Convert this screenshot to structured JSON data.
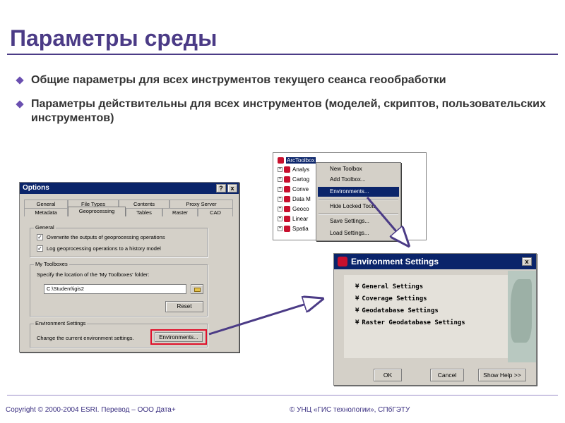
{
  "slide": {
    "title": "Параметры среды",
    "bullets": [
      "Общие параметры для всех инструментов текущего сеанса геообработки",
      "Параметры действительны для всех инструментов (моделей, скриптов, пользовательских инструментов)"
    ]
  },
  "options_dialog": {
    "title": "Options",
    "help_button": "?",
    "close_button": "x",
    "tabs_back": [
      "General",
      "File Types",
      "Contents",
      "Proxy Server"
    ],
    "tabs_front": [
      "Metadata",
      "Geoprocessing",
      "Tables",
      "Raster",
      "CAD"
    ],
    "active_tab": "Geoprocessing",
    "general_group": {
      "label": "General",
      "checkbox1": "Overwrite the outputs of geoprocessing operations",
      "checkbox2": "Log geoprocessing operations to a history model",
      "checkbox1_checked": "✓",
      "checkbox2_checked": "✓"
    },
    "toolboxes_group": {
      "label": "My Toolboxes",
      "description": "Specify the location of the 'My Toolboxes' folder:",
      "path_value": "C:\\Student\\igis2",
      "reset_button": "Reset"
    },
    "environment_group": {
      "label": "Environment Settings",
      "description": "Change the current environment settings.",
      "environments_button": "Environments..."
    }
  },
  "arctoolbox": {
    "root": "ArcToolbox",
    "items": [
      "Analys",
      "Cartog",
      "Conve",
      "Data M",
      "Geoco",
      "Linear",
      "Spatia"
    ]
  },
  "context_menu": {
    "items": [
      "New Toolbox",
      "Add Toolbox...",
      "Environments...",
      "Hide Locked Tools",
      "Save Settings...",
      "Load Settings..."
    ],
    "highlighted": "Environments..."
  },
  "env_dialog": {
    "title": "Environment Settings",
    "close_button": "x",
    "sections": [
      "General Settings",
      "Coverage Settings",
      "Geodatabase Settings",
      "Raster Geodatabase Settings"
    ],
    "chevron": "¥",
    "ok_button": "OK",
    "cancel_button": "Cancel",
    "help_button": "Show Help >>"
  },
  "footer": {
    "left": "Copyright © 2000-2004 ESRI. Перевод  – ООО Дата+",
    "right": "© УНЦ «ГИС технологии», СПбГЭТУ"
  },
  "colors": {
    "title": "#4b3b86",
    "titlebar": "#0a246a",
    "highlight_box": "#e0102a",
    "arrow": "#4b3b86"
  }
}
